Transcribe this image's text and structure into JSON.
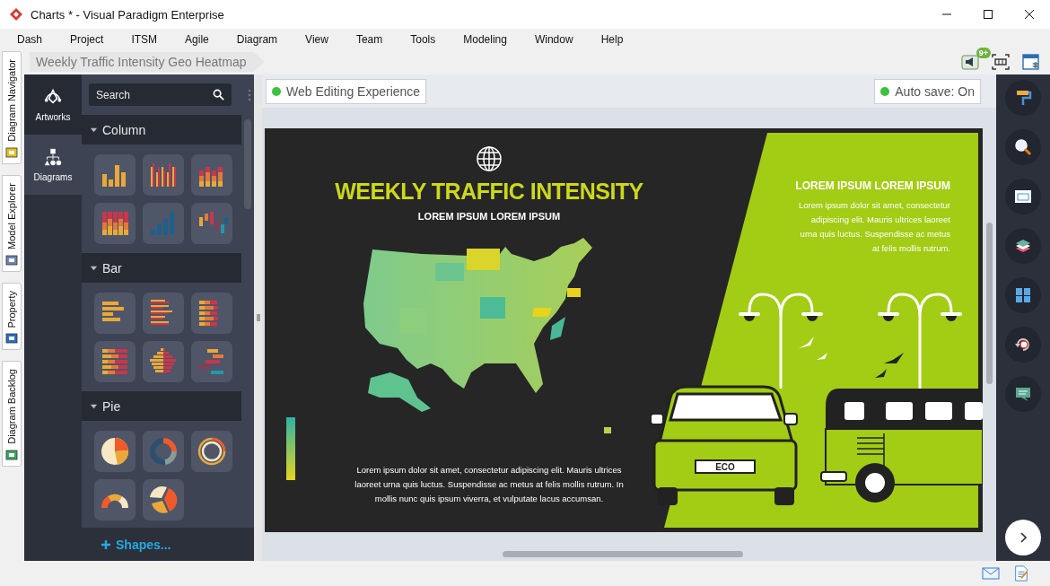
{
  "window": {
    "title": "Charts * - Visual Paradigm Enterprise"
  },
  "menu": [
    "Dash",
    "Project",
    "ITSM",
    "Agile",
    "Diagram",
    "View",
    "Team",
    "Tools",
    "Modeling",
    "Window",
    "Help"
  ],
  "side_tabs": [
    "Diagram Navigator",
    "Model Explorer",
    "Property",
    "Diagram Backlog"
  ],
  "breadcrumb": "Weekly Traffic Intensity Geo Heatmap",
  "toolbar": {
    "notification_badge": "9+"
  },
  "palette": {
    "nav": [
      {
        "label": "Artworks",
        "selected": false
      },
      {
        "label": "Diagrams",
        "selected": true
      }
    ],
    "search": {
      "placeholder": "Search"
    },
    "sections": [
      {
        "title": "Column",
        "expanded": true,
        "items": [
          {
            "kind": "column"
          },
          {
            "kind": "column-multi"
          },
          {
            "kind": "column-stacked"
          },
          {
            "kind": "column-stacked-full"
          },
          {
            "kind": "column-step"
          },
          {
            "kind": "column-float"
          }
        ]
      },
      {
        "title": "Bar",
        "expanded": true,
        "items": [
          {
            "kind": "bar"
          },
          {
            "kind": "bar-multi"
          },
          {
            "kind": "bar-stacked"
          },
          {
            "kind": "bar-stacked-full"
          },
          {
            "kind": "bar-pyramid"
          },
          {
            "kind": "bar-gantt"
          }
        ]
      },
      {
        "title": "Pie",
        "expanded": true,
        "items": [
          {
            "kind": "pie"
          },
          {
            "kind": "donut"
          },
          {
            "kind": "ring"
          },
          {
            "kind": "gauge"
          },
          {
            "kind": "pie-exploded"
          }
        ]
      }
    ],
    "shapes_link": "Shapes..."
  },
  "canvas": {
    "web_editing": "Web Editing Experience",
    "auto_save": "Auto save: On",
    "slide": {
      "title": "WEEKLY TRAFFIC INTENSITY",
      "subtitle": "LOREM IPSUM LOREM IPSUM",
      "body": "Lorem ipsum dolor sit amet, consectetur adipiscing elit. Mauris ultrices laoreet urna quis luctus. Suspendisse ac metus at felis mollis rutrum. In mollis nunc quis ipsum viverra, et vulputate lacus accumsan.",
      "side_heading": "LOREM IPSUM LOREM IPSUM",
      "side_text": "Lorem ipsum dolor sit amet, consectetur adipiscing elit. Mauris ultrices laoreet urna quis luctus. Suspendisse ac metus at felis mollis rutrum.",
      "plate": "ECO"
    }
  }
}
